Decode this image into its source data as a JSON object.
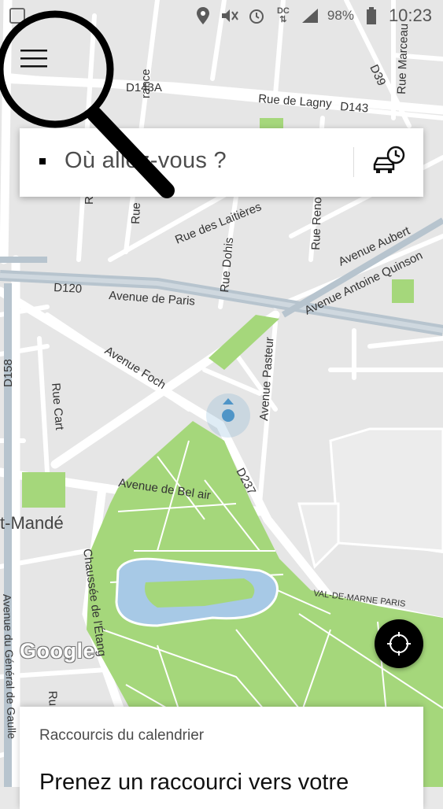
{
  "status_bar": {
    "battery_percent": "98%",
    "time": "10:23",
    "network_label": "DC"
  },
  "search": {
    "placeholder": "Où allez-vous ?"
  },
  "map": {
    "streets": {
      "d143a": "D143A",
      "rue_de_lagny": "Rue de Lagny",
      "d143": "D143",
      "d39": "D39",
      "rue_marceau": "Rue Marceau",
      "rance": "rance",
      "rue_des_laitieres": "Rue des Laitières",
      "rue_dohis": "Rue Dohis",
      "rue_renon": "Rue Renon",
      "avenue_aubert": "Avenue Aubert",
      "avenue_antoine_quinson": "Avenue Antoine Quinson",
      "d120": "D120",
      "avenue_de_paris": "Avenue de Paris",
      "avenue_foch": "Avenue Foch",
      "avenue_pasteur": "Avenue Pasteur",
      "d158": "D158",
      "rue_cart": "Rue Cart",
      "avenue_de_bel_air": "Avenue de Bel air",
      "d237": "D237",
      "t_mande": "t-Mandé",
      "chaussee": "Chaussée de l'Étang",
      "val_de_marne": "VAL-DE-MARNE",
      "paris": "PARIS",
      "avenue_general": "Avenue du Général de Gaulle",
      "ru": "Ru",
      "rue_left": "Ru",
      "rue_top": "Rue"
    },
    "colors": {
      "background": "#e8e8e8",
      "road": "#ffffff",
      "highway": "#b7c4ce",
      "park": "#a5d77b",
      "water": "#a7c9e6",
      "location": "#4f95c7"
    }
  },
  "google_logo": "Google",
  "calendar_card": {
    "title": "Raccourcis du calendrier",
    "body": "Prenez un raccourci vers votre"
  }
}
